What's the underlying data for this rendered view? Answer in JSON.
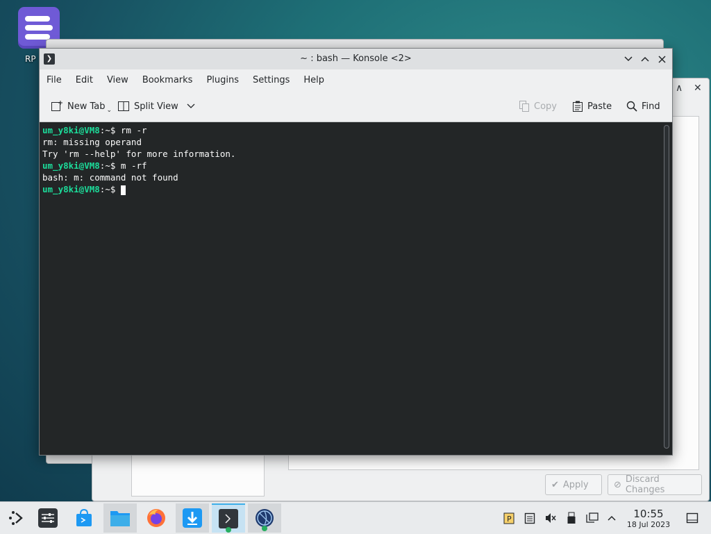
{
  "desktop": {
    "icon_label": "RP",
    "wallpaper_colors": [
      "#2f8b8a",
      "#174f60",
      "#0f3a4c"
    ]
  },
  "background_window": {
    "apply_label": "Apply",
    "discard_label": "Discard Changes"
  },
  "konsole": {
    "title": "~ : bash — Konsole <2>",
    "menu": [
      "File",
      "Edit",
      "View",
      "Bookmarks",
      "Plugins",
      "Settings",
      "Help"
    ],
    "toolbar": {
      "new_tab": "New Tab",
      "split_view": "Split View",
      "copy": "Copy",
      "paste": "Paste",
      "find": "Find"
    },
    "terminal": {
      "lines": [
        {
          "prompt": "um_y8ki@VM8",
          "path": ":~$ ",
          "text": "rm -r"
        },
        {
          "text": "rm: missing operand"
        },
        {
          "text": "Try 'rm --help' for more information."
        },
        {
          "prompt": "um_y8ki@VM8",
          "path": ":~$ ",
          "text": "m -rf"
        },
        {
          "text": "bash: m: command not found"
        },
        {
          "prompt": "um_y8ki@VM8",
          "path": ":~$ ",
          "text": ""
        }
      ]
    }
  },
  "taskbar": {
    "clock": {
      "time": "10:55",
      "date": "18 Jul 2023"
    },
    "apps": [
      "application-launcher",
      "system-settings",
      "discover-store",
      "file-manager",
      "firefox",
      "downloader",
      "konsole",
      "network-browser"
    ]
  },
  "colors": {
    "accent": "#3daee9",
    "prompt": "#1cdc9a",
    "terminal_bg": "#232627"
  }
}
